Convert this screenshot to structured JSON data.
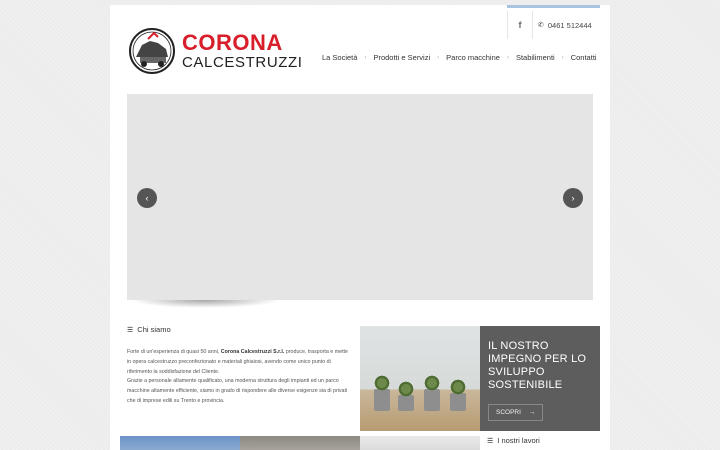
{
  "header": {
    "social_icon": "facebook-icon",
    "social_glyph": "f",
    "phone_icon": "phone-icon",
    "phone": "0461 512444"
  },
  "logo": {
    "name": "CORONA",
    "sub": "CALCESTRUZZI",
    "brand_color": "#d81e2a"
  },
  "nav": {
    "items": [
      "La Società",
      "Prodotti e Servizi",
      "Parco macchine",
      "Stabilimenti",
      "Contatti"
    ]
  },
  "slider": {
    "prev_glyph": "‹",
    "next_glyph": "›"
  },
  "about": {
    "title": "Chi siamo",
    "p1_a": "Forte di un'esperienza di quasi 50 anni, ",
    "p1_b": "Corona Calcestruzzi S.r.l.",
    "p1_c": " produce, trasporta e mette in opera calcestruzzo preconfezionato e materiali ghiaiosi, avendo come unico punto di riferimento la soddisfazione del Cliente.",
    "p2": "Grazie a personale altamente qualificato, una moderna struttura degli impianti ed un parco macchine altamente efficiente, siamo in grado di rispondere alle diverse esigenze sia di privati che di imprese edili su Trento e provincia."
  },
  "promo": {
    "title": "IL NOSTRO IMPEGNO PER LO SVILUPPO SOSTENIBILE",
    "button": "SCOPRI",
    "button_arrow": "→",
    "box_color": "#5d5d5d"
  },
  "works": {
    "title": "I nostri lavori"
  }
}
